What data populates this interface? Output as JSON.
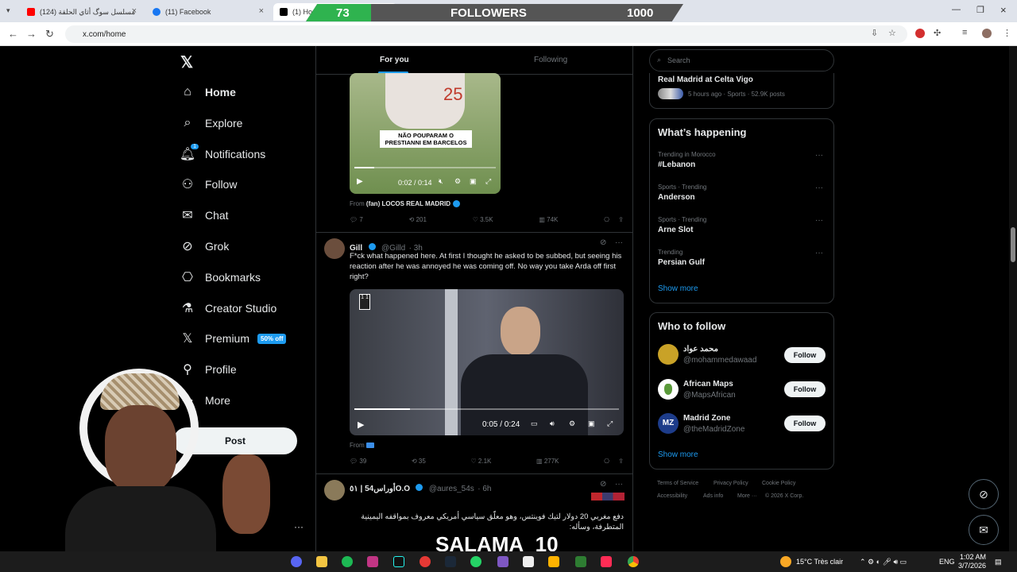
{
  "browser": {
    "tabs": [
      {
        "label": "(124) مسلسل سوگ أثاي الحلقة",
        "favicon_color": "#ff0000"
      },
      {
        "label": "(11) Facebook",
        "favicon_color": "#1877f2"
      },
      {
        "label": "(1) Home",
        "favicon_color": "#000000"
      }
    ],
    "url": "x.com/home"
  },
  "followers_overlay": {
    "current": "73",
    "label": "FOLLOWERS",
    "goal": "1000",
    "progress": 0.073
  },
  "sidebar": {
    "items": [
      {
        "label": "Home",
        "icon": "home-icon"
      },
      {
        "label": "Explore",
        "icon": "search-icon"
      },
      {
        "label": "Notifications",
        "icon": "bell-icon"
      },
      {
        "label": "Follow",
        "icon": "person-plus-icon"
      },
      {
        "label": "Chat",
        "icon": "mail-icon"
      },
      {
        "label": "Grok",
        "icon": "grok-icon"
      },
      {
        "label": "Bookmarks",
        "icon": "bookmark-icon"
      },
      {
        "label": "Creator Studio",
        "icon": "flask-icon"
      },
      {
        "label": "Premium",
        "icon": "x-icon"
      },
      {
        "label": "Profile",
        "icon": "person-icon"
      },
      {
        "label": "More",
        "icon": "more-circle-icon"
      }
    ],
    "notifications_count": "1",
    "premium_badge": "50% off",
    "post_label": "Post"
  },
  "feed": {
    "tabs": [
      "For you",
      "Following"
    ],
    "tweet1": {
      "video_caption": "NÃO POUPARAM O PRESTIANNI EM BARCELOS",
      "video_time": "0:02 / 0:14",
      "video_progress": 0.14,
      "from_label": "From",
      "from_source": "(fan) LOCOS REAL MADRID",
      "stats": {
        "replies": "7",
        "reposts": "201",
        "likes": "3.5K",
        "views": "74K"
      }
    },
    "tweet2": {
      "name": "Gill",
      "handle": "@Gilld",
      "time": "· 3h",
      "text": "F*ck what happened here. At first I thought he asked to be subbed, but seeing his reaction after he was annoyed he was coming off. No way you take Arda off first right?",
      "video_time": "0:05 / 0:24",
      "video_progress": 0.21,
      "from_label": "From",
      "stats": {
        "replies": "39",
        "reposts": "35",
        "likes": "2.1K",
        "views": "277K"
      }
    },
    "tweet3": {
      "name": "أوراس54 | ٥١O.O",
      "handle": "@aures_54s",
      "time": "· 6h",
      "text": "دفع مغربي 20 دولار لتيك فوينتس، وهو معلّق سياسي أمريكي معروف بمواقفه اليمينية المتطرفة، وسأله:"
    }
  },
  "right": {
    "search_placeholder": "Search",
    "top_trend": {
      "name": "Real Madrid at Celta Vigo",
      "meta": "5 hours ago · Sports · 52.9K posts"
    },
    "whats_happening": {
      "title": "What’s happening",
      "trends": [
        {
          "context": "Trending in Morocco",
          "name": "#Lebanon"
        },
        {
          "context": "Sports · Trending",
          "name": "Anderson"
        },
        {
          "context": "Sports · Trending",
          "name": "Arne Slot"
        },
        {
          "context": "Trending",
          "name": "Persian Gulf"
        }
      ],
      "show_more": "Show more"
    },
    "who_to_follow": {
      "title": "Who to follow",
      "people": [
        {
          "name": "محمد عواد",
          "handle": "@mohammedawaad"
        },
        {
          "name": "African Maps",
          "handle": "@MapsAfrican"
        },
        {
          "name": "Madrid Zone",
          "handle": "@theMadridZone"
        }
      ],
      "follow_label": "Follow",
      "show_more": "Show more"
    },
    "footer": [
      "Terms of Service",
      "Privacy Policy",
      "Cookie Policy",
      "Accessibility",
      "Ads info",
      "More ···",
      "© 2026 X Corp."
    ]
  },
  "overlay_text": "SALAMA_10",
  "taskbar": {
    "weather": "15°C  Très clair",
    "lang": "ENG",
    "time": "1:02 AM",
    "date": "3/7/2026"
  }
}
